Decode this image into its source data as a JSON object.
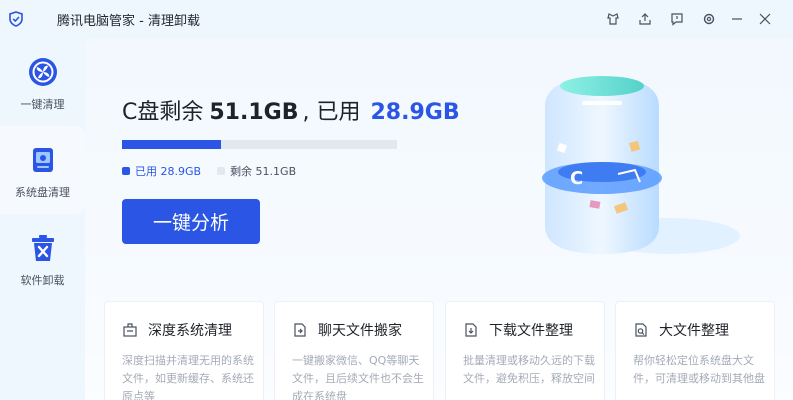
{
  "window": {
    "title": "腾讯电脑管家 - 清理卸载"
  },
  "sidebar": {
    "items": [
      {
        "label": "一键清理",
        "icon": "fan-clean-icon"
      },
      {
        "label": "系统盘清理",
        "icon": "system-disk-icon"
      },
      {
        "label": "软件卸载",
        "icon": "uninstall-bin-icon"
      }
    ],
    "active_index": 1
  },
  "disk": {
    "headline_prefix": "C盘剩余",
    "free": "51.1GB",
    "separator": ", 已用",
    "used": "28.9GB",
    "used_fraction": 0.361,
    "legend_used": "已用 28.9GB",
    "legend_free": "剩余 51.1GB"
  },
  "actions": {
    "analyze_label": "一键分析"
  },
  "cards": [
    {
      "title": "深度系统清理",
      "desc": "深度扫描并清理无用的系统文件，如更新缓存、系统还原点等",
      "icon": "deep-clean-icon"
    },
    {
      "title": "聊天文件搬家",
      "desc": "一键搬家微信、QQ等聊天文件，且后续文件也不会生成在系统盘",
      "icon": "chat-move-icon"
    },
    {
      "title": "下载文件整理",
      "desc": "批量清理或移动久远的下载文件，避免积压，释放空间",
      "icon": "download-organize-icon"
    },
    {
      "title": "大文件整理",
      "desc": "帮你轻松定位系统盘大文件，可清理或移动到其他盘",
      "icon": "large-file-icon"
    }
  ],
  "colors": {
    "accent": "#2a55e5",
    "sidebar_bg": "#eef6fe"
  }
}
